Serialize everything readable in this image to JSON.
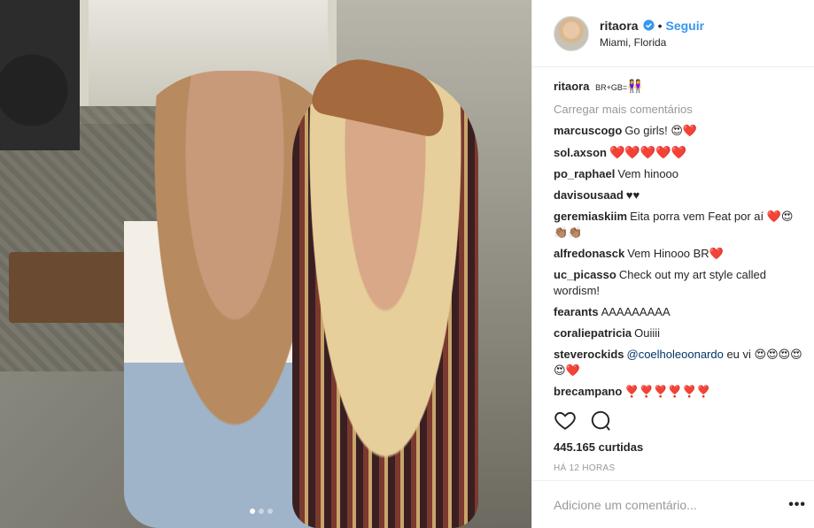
{
  "post": {
    "username": "ritaora",
    "follow_label": "Seguir",
    "separator": "•",
    "location": "Miami, Florida",
    "caption_user": "ritaora",
    "caption_text": "BR+GB=",
    "caption_emoji": "👭",
    "load_more": "Carregar mais comentários",
    "likes": "445.165 curtidas",
    "timestamp": "HÁ 12 HORAS",
    "add_comment_placeholder": "Adicione um comentário...",
    "more_options": "•••"
  },
  "comments": [
    {
      "user": "marcuscogo",
      "text": "Go girls! 😍❤️"
    },
    {
      "user": "sol.axson",
      "text": "❤️❤️❤️❤️❤️"
    },
    {
      "user": "po_raphael",
      "text": "Vem hinooo"
    },
    {
      "user": "davisousaad",
      "text": "♥♥"
    },
    {
      "user": "geremiaskiim",
      "text": "Eita porra vem Feat por aí ❤️😍👏🏽👏🏽"
    },
    {
      "user": "alfredonasck",
      "text": "Vem Hinooo BR❤️"
    },
    {
      "user": "uc_picasso",
      "text": "Check out my art style called wordism!"
    },
    {
      "user": "fearants",
      "text": "AAAAAAAAA"
    },
    {
      "user": "coraliepatricia",
      "text": "Ouiiii"
    },
    {
      "user": "steverockids",
      "mention": "@coelholeoonardo",
      "text": " eu vi 😍😍😍😍😍❤️"
    },
    {
      "user": "brecampano",
      "text": "❣️❣️❣️❣️❣️❣️"
    }
  ],
  "colors": {
    "accent": "#3897f0",
    "heart": "#e01b3c"
  },
  "carousel": {
    "slides": 3,
    "active": 1
  }
}
